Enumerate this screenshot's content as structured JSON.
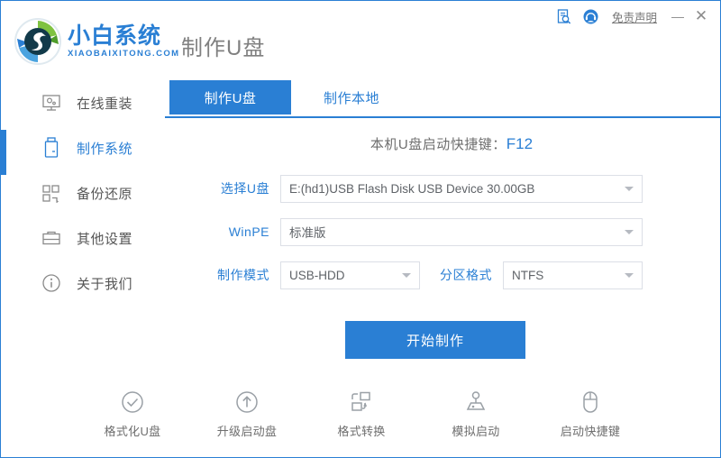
{
  "window": {
    "brand_name": "小白系统",
    "brand_sub": "XIAOBAIXITONG.COM",
    "page_heading": "制作U盘",
    "disclaimer_label": "免责声明",
    "minimize_label": "—",
    "close_label": "✕",
    "log_icon": "document-search-icon",
    "support_icon": "headset-icon",
    "accent_color": "#2a7fd4"
  },
  "sidebar": {
    "items": [
      {
        "label": "在线重装",
        "icon": "monitor-icon",
        "active": false
      },
      {
        "label": "制作系统",
        "icon": "usb-drive-icon",
        "active": true
      },
      {
        "label": "备份还原",
        "icon": "blocks-icon",
        "active": false
      },
      {
        "label": "其他设置",
        "icon": "toolbox-icon",
        "active": false
      },
      {
        "label": "关于我们",
        "icon": "info-circle-icon",
        "active": false
      }
    ]
  },
  "main": {
    "tabs": [
      {
        "label": "制作U盘",
        "active": true
      },
      {
        "label": "制作本地",
        "active": false
      }
    ],
    "hotkey_text": "本机U盘启动快捷键：",
    "hotkey_value": "F12",
    "fields": [
      {
        "label": "选择U盘",
        "value": "E:(hd1)USB Flash Disk USB Device 30.00GB"
      },
      {
        "label": "WinPE",
        "value": "标准版"
      },
      {
        "label": "制作模式",
        "value": "USB-HDD"
      },
      {
        "label": "分区格式",
        "value": "NTFS"
      }
    ],
    "start_button_label": "开始制作"
  },
  "bottom_tools": [
    {
      "label": "格式化U盘",
      "icon": "check-circle-icon"
    },
    {
      "label": "升级启动盘",
      "icon": "arrow-up-circle-icon"
    },
    {
      "label": "格式转换",
      "icon": "convert-shapes-icon"
    },
    {
      "label": "模拟启动",
      "icon": "joystick-icon"
    },
    {
      "label": "启动快捷键",
      "icon": "mouse-icon"
    }
  ]
}
